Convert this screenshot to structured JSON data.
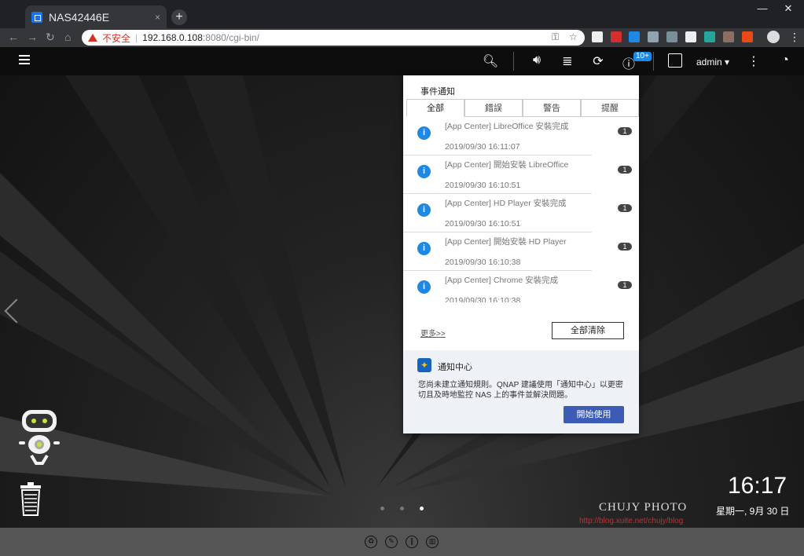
{
  "browser": {
    "tab_title": "NAS42446E",
    "tab_close": "×",
    "new_tab": "+",
    "insecure_label": "不安全",
    "url_host": "192.168.0.108",
    "url_rest": ":8080/cgi-bin/",
    "window_min": "—",
    "window_max": "☐",
    "window_close": "✕"
  },
  "topbar": {
    "user": "admin",
    "notification_badge": "10+"
  },
  "panel": {
    "title": "事件通知",
    "tabs": [
      {
        "label": "全部"
      },
      {
        "label": "錯誤"
      },
      {
        "label": "警告"
      },
      {
        "label": "提醒"
      }
    ],
    "notifications": [
      {
        "message": "[App Center] LibreOffice 安裝完成",
        "time": "2019/09/30 16:11:07",
        "count": "1"
      },
      {
        "message": "[App Center] 開始安裝 LibreOffice",
        "time": "2019/09/30 16:10:51",
        "count": "1"
      },
      {
        "message": "[App Center] HD Player 安裝完成",
        "time": "2019/09/30 16:10:51",
        "count": "1"
      },
      {
        "message": "[App Center] 開始安裝 HD Player",
        "time": "2019/09/30 16:10:38",
        "count": "1"
      },
      {
        "message": "[App Center] Chrome 安裝完成",
        "time": "2019/09/30 16:10:38",
        "count": "1"
      }
    ],
    "more_link": "更多>>",
    "clear_all": "全部清除",
    "notification_center": {
      "title": "通知中心",
      "description": "您尚未建立通知規則。QNAP 建議使用「通知中心」以更密切且及時地監控 NAS 上的事件並解決問題。",
      "start_button": "開始使用"
    }
  },
  "desktop": {
    "clock_time": "16:17",
    "clock_date": "星期一, 9月 30 日",
    "watermark_title": "CHUJY PHOTO",
    "watermark_url": "http://blog.xuite.net/chujy/blog",
    "page_dots": 3,
    "active_page": 3
  },
  "colors": {
    "accent_blue": "#1e88e5",
    "primary_button": "#3b5bb5",
    "insecure_red": "#d93025"
  }
}
